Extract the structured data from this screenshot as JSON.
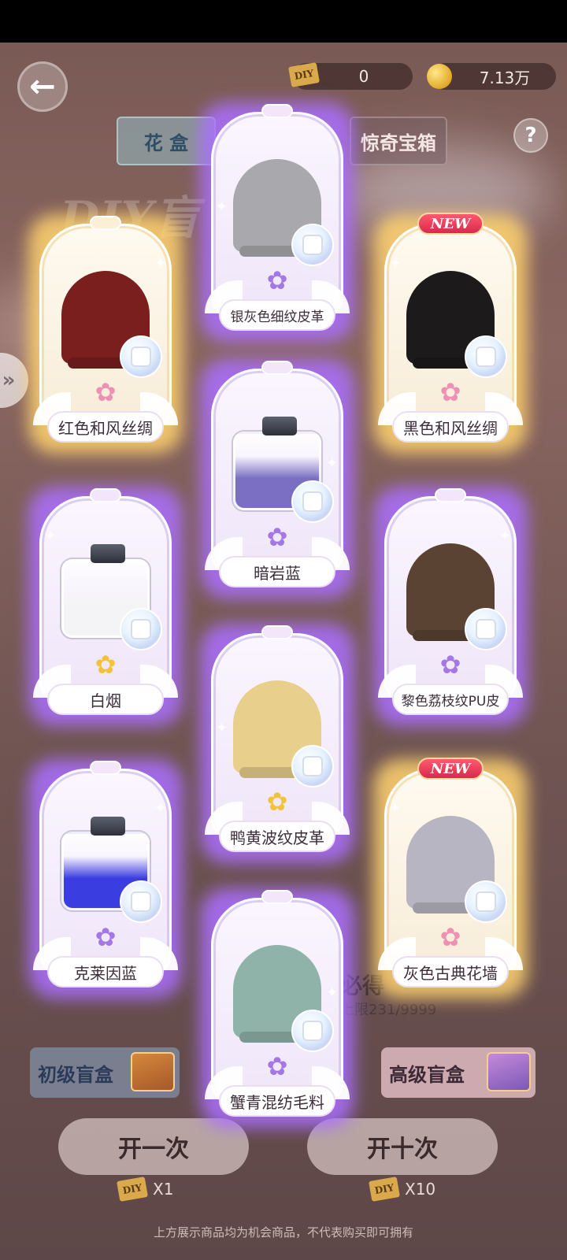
{
  "header": {
    "diy_label": "DIY",
    "diy_value": "0",
    "coin_value": "7.13万",
    "back_icon": "arrow-left-icon",
    "help_label": "?"
  },
  "tabs": [
    {
      "label": "花 盒"
    },
    {
      "label": "惊奇宝箱"
    }
  ],
  "background": {
    "title": "DIY盲",
    "guarantee": "必得",
    "limit": "上限231/9999"
  },
  "side_nav": {
    "label": "»"
  },
  "boxes": [
    {
      "label": "初级盲盒"
    },
    {
      "label": "高级盲盒"
    }
  ],
  "actions": {
    "open_once": "开一次",
    "open_ten": "开十次",
    "cost_once": "X1",
    "cost_ten": "X10"
  },
  "disclaimer": "上方展示商品均为机会商品，不代表购买即可拥有",
  "rewards": [
    {
      "name": "银灰色细纹皮革",
      "rarity": "purple",
      "type": "fabric",
      "color": "#a9a9ad",
      "flower": "purple",
      "new": false
    },
    {
      "name": "红色和风丝绸",
      "rarity": "gold",
      "type": "fabric",
      "color": "#7a1e1e",
      "flower": "rainbow",
      "new": false
    },
    {
      "name": "黑色和风丝绸",
      "rarity": "gold",
      "type": "fabric",
      "color": "#1d1a1c",
      "flower": "rainbow",
      "new": true,
      "new_label": "NEW"
    },
    {
      "name": "暗岩蓝",
      "rarity": "purple",
      "type": "bottle",
      "color": "#7a6fc2",
      "flower": "purple",
      "new": false
    },
    {
      "name": "白烟",
      "rarity": "purple",
      "type": "bottle",
      "color": "#f4f4f6",
      "flower": "gold",
      "new": false
    },
    {
      "name": "黎色荔枝纹PU皮",
      "rarity": "purple",
      "type": "fabric",
      "color": "#5b4334",
      "flower": "purple",
      "new": false
    },
    {
      "name": "鸭黄波纹皮革",
      "rarity": "purple",
      "type": "fabric",
      "color": "#e8cf8c",
      "flower": "gold",
      "new": false
    },
    {
      "name": "克莱因蓝",
      "rarity": "purple",
      "type": "bottle",
      "color": "#3a3ee0",
      "flower": "purple",
      "new": false
    },
    {
      "name": "灰色古典花墙",
      "rarity": "gold",
      "type": "fabric",
      "color": "#b8b5c2",
      "flower": "rainbow",
      "new": true,
      "new_label": "NEW"
    },
    {
      "name": "蟹青混纺毛料",
      "rarity": "purple",
      "type": "fabric",
      "color": "#8fb3a8",
      "flower": "purple",
      "new": false
    }
  ],
  "colors": {
    "purple_glow": "#aa6eff",
    "gold_glow": "#ffd26e",
    "new_tag": "#d82a4c"
  }
}
